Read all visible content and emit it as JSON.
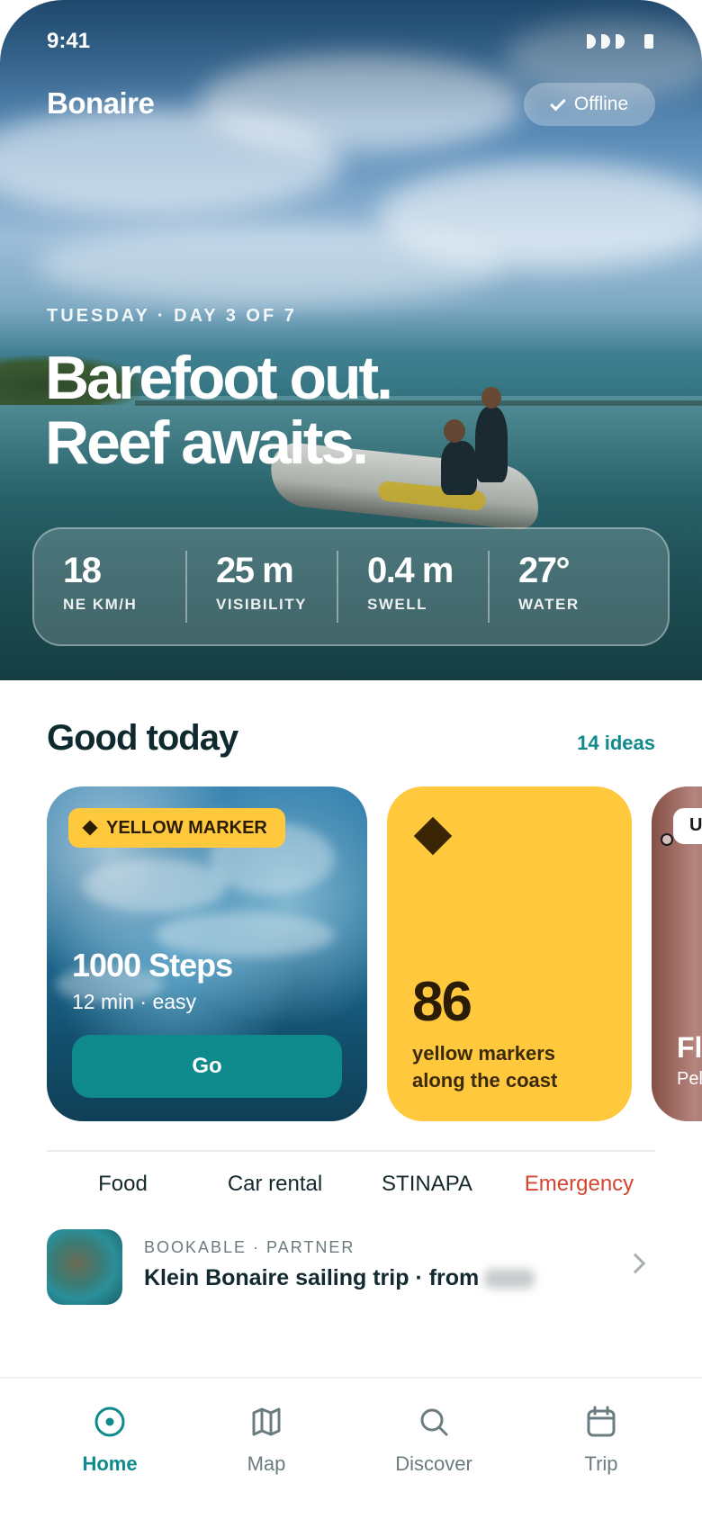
{
  "status_bar": {
    "time": "9:41"
  },
  "header": {
    "app_title": "Bonaire",
    "offline_label": "Offline"
  },
  "hero": {
    "eyebrow": "TUESDAY · DAY 3 OF 7",
    "headline_line1": "Barefoot out.",
    "headline_line2": "Reef awaits."
  },
  "stats": [
    {
      "value": "18",
      "label": "NE KM/H"
    },
    {
      "value": "25 m",
      "label": "VISIBILITY"
    },
    {
      "value": "0.4 m",
      "label": "SWELL"
    },
    {
      "value": "27°",
      "label": "WATER"
    }
  ],
  "section": {
    "title": "Good today",
    "link": "14 ideas"
  },
  "cards": {
    "dive": {
      "badge": "YELLOW MARKER",
      "title": "1000 Steps",
      "subtitle": "12 min · easy",
      "button": "Go"
    },
    "markers": {
      "count": "86",
      "text": "yellow markers along the coast"
    },
    "next": {
      "badge": "U",
      "title": "Fl",
      "subtitle": "Pel"
    }
  },
  "quick_links": [
    "Food",
    "Car rental",
    "STINAPA",
    "Emergency"
  ],
  "partner": {
    "eyebrow": "BOOKABLE · PARTNER",
    "title": "Klein Bonaire sailing trip · from"
  },
  "tabbar": {
    "tabs": [
      "Home",
      "Map",
      "Discover",
      "Trip"
    ],
    "active": "Home"
  },
  "colors": {
    "accent": "#0e8a8c",
    "marker_yellow": "#ffc83d",
    "emergency": "#d4442f"
  },
  "icons": [
    "check-icon",
    "diamond-icon",
    "chevron-right-icon",
    "home-icon",
    "map-icon",
    "search-icon",
    "calendar-icon"
  ]
}
